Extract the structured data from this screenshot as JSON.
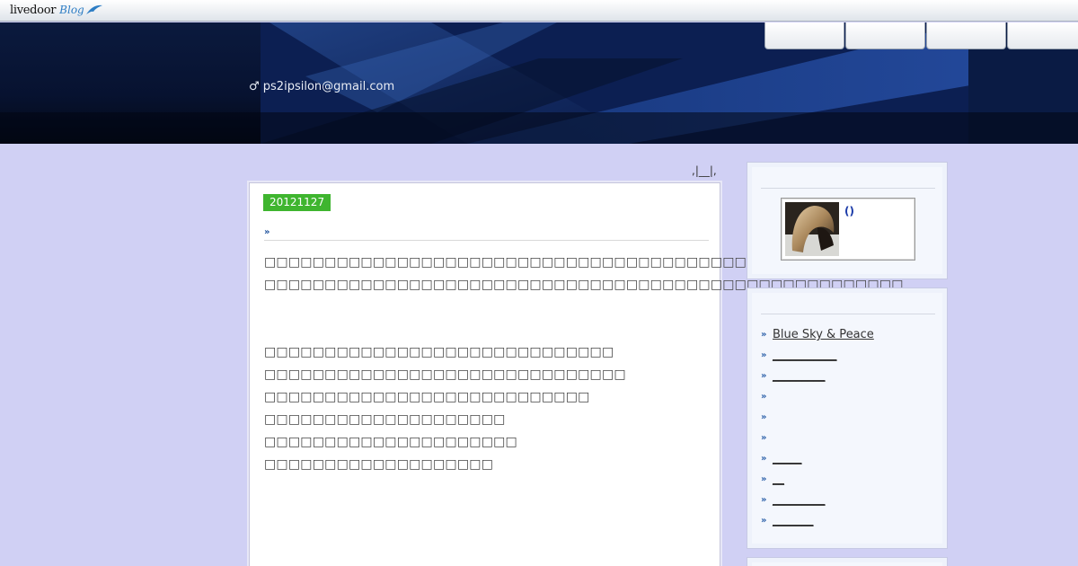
{
  "topbar": {
    "logo_text": "livedoor",
    "logo_blog": "Blog",
    "logo_icon": "dolphin-icon"
  },
  "header": {
    "email": "♂ ps2ipsilon@gmail.com",
    "tabs": [
      "",
      "",
      "",
      ""
    ]
  },
  "pager": ",|__|,",
  "article": {
    "date": "20121127",
    "title_bullet": "»",
    "title": "",
    "lines": [
      "□□□□□□□□□□□□□□□□□□□□□□□□□□□□□□□□□□□□□□□□",
      "□□□□□□□□□□□□□□□□□□□□□□□□□□□□□□□□□□□□□□□□□□□□□□□□□□□□□",
      "",
      "□□□□□□□□□□□□□□□□□□□□□□□□□□□□□",
      "□□□□□□□□□□□□□□□□□□□□□□□□□□□□□□",
      "□□□□□□□□□□□□□□□□□□□□□□□□□□□",
      "□□□□□□□□□□□□□□□□□□□□",
      "□□□□□□□□□□□□□□□□□□□□□",
      "□□□□□□□□□□□□□□□□□□□"
    ]
  },
  "sidebar": {
    "profile": {
      "name": "()",
      "avatar_icon": "profile-photo"
    },
    "links_bullet": "»",
    "links": [
      "Blue Sky & Peace",
      "___________",
      "_________",
      "",
      "",
      "",
      "_____",
      "__",
      "_________",
      "_______"
    ]
  },
  "colors": {
    "page_bg": "#d0d0f4",
    "date_badge": "#3fb52f",
    "banner_dark": "#071230",
    "link_bullet": "#2a5fa8",
    "profile_name": "#1a3aa8"
  }
}
